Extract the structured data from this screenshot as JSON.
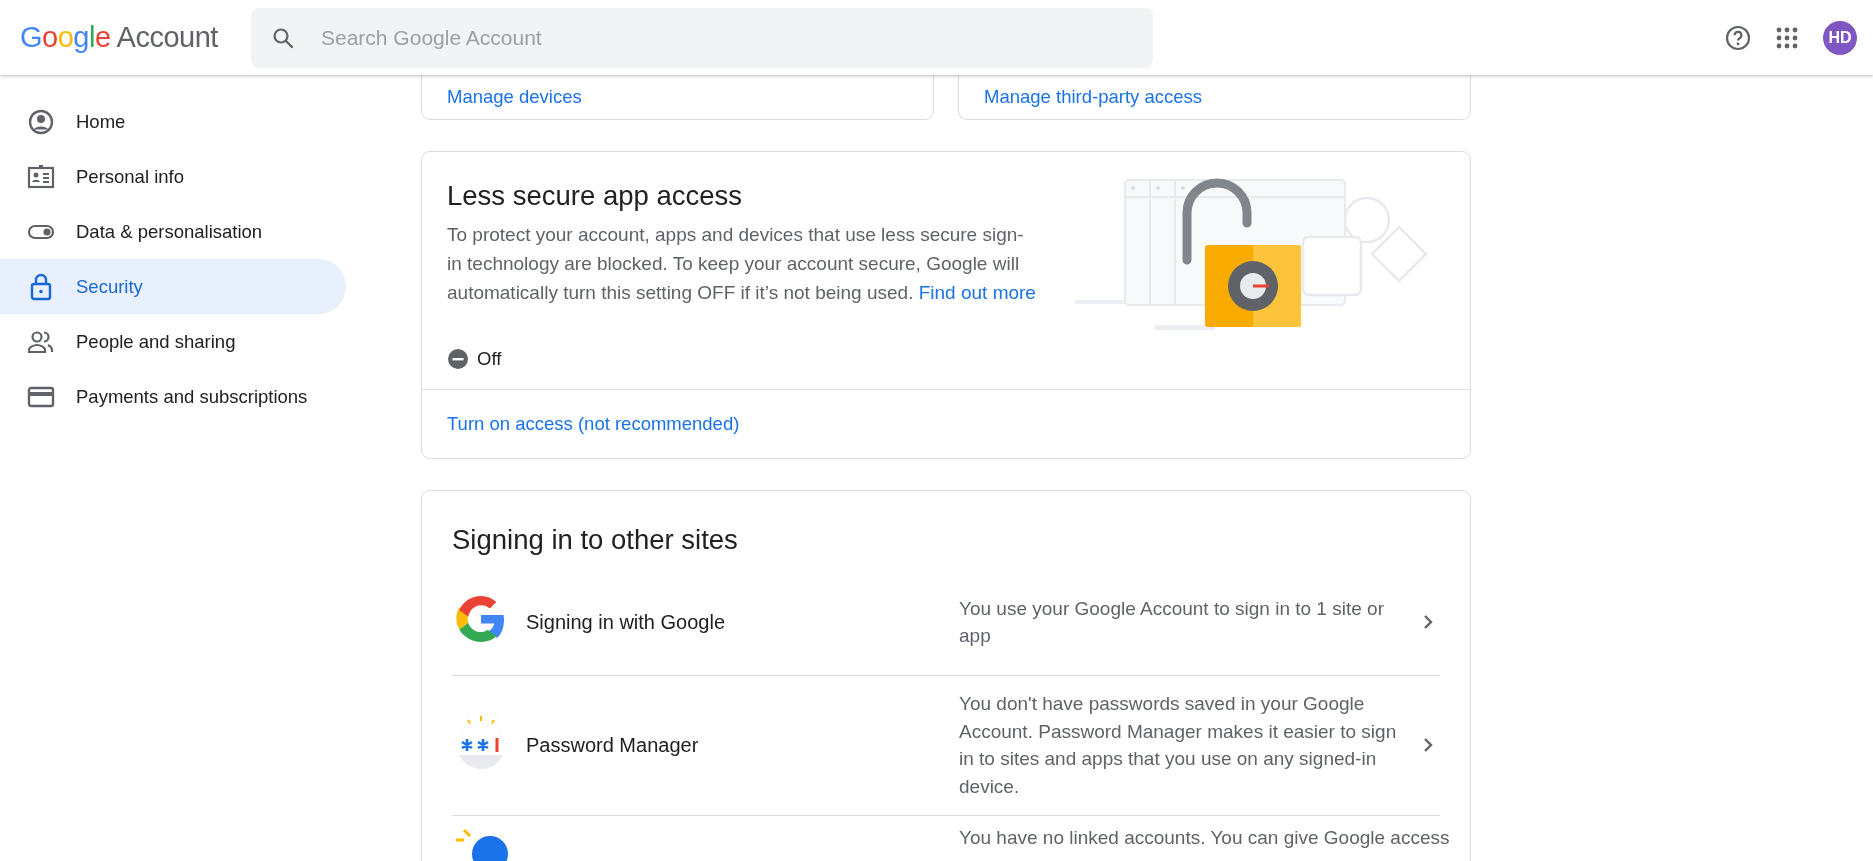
{
  "header": {
    "logo": {
      "brand": "Google",
      "product": "Account"
    },
    "search": {
      "placeholder": "Search Google Account"
    },
    "avatar": {
      "initials": "HD"
    }
  },
  "sidebar": {
    "items": [
      {
        "label": "Home",
        "selected": false
      },
      {
        "label": "Personal info",
        "selected": false
      },
      {
        "label": "Data & personalisation",
        "selected": false
      },
      {
        "label": "Security",
        "selected": true
      },
      {
        "label": "People and sharing",
        "selected": false
      },
      {
        "label": "Payments and subscriptions",
        "selected": false
      }
    ]
  },
  "top_cards": [
    {
      "link": "Manage devices"
    },
    {
      "link": "Manage third-party access"
    }
  ],
  "less_secure": {
    "title": "Less secure app access",
    "description": "To protect your account, apps and devices that use less secure sign-in technology are blocked. To keep your account secure, Google will automatically turn this setting OFF if it’s not being used.",
    "link": "Find out more",
    "status": {
      "label": "Off",
      "on": false
    },
    "action": "Turn on access (not recommended)"
  },
  "signing_in": {
    "title": "Signing in to other sites",
    "rows": [
      {
        "label": "Signing in with Google",
        "description": "You use your Google Account to sign in to 1 site or app"
      },
      {
        "label": "Password Manager",
        "description": "You don't have passwords saved in your Google Account. Password Manager makes it easier to sign in to sites and apps that you use on any signed-in device."
      },
      {
        "description": "You have no linked accounts. You can give Google access"
      }
    ]
  }
}
